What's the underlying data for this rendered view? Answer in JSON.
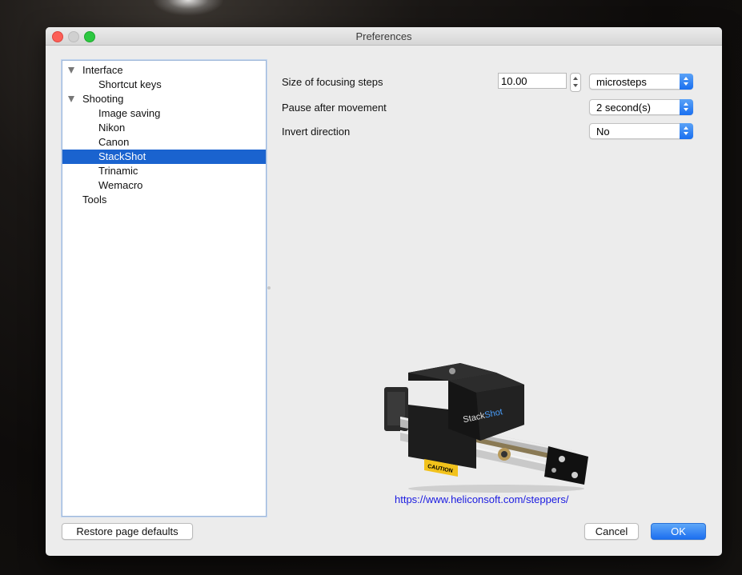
{
  "window": {
    "title": "Preferences"
  },
  "tree": {
    "items": [
      {
        "label": "Interface",
        "expanded": true
      },
      {
        "label": "Shortcut keys"
      },
      {
        "label": "Shooting",
        "expanded": true
      },
      {
        "label": "Image saving"
      },
      {
        "label": "Nikon"
      },
      {
        "label": "Canon"
      },
      {
        "label": "StackShot",
        "selected": true
      },
      {
        "label": "Trinamic"
      },
      {
        "label": "Wemacro"
      },
      {
        "label": "Tools"
      }
    ]
  },
  "settings": {
    "focus_steps": {
      "label": "Size of focusing steps",
      "value": "10.00",
      "unit": "microsteps"
    },
    "pause": {
      "label": "Pause after movement",
      "value": "2  second(s)"
    },
    "invert": {
      "label": "Invert direction",
      "value": "No"
    }
  },
  "product": {
    "brand_a": "Stack",
    "brand_b": "Shot",
    "caution": "CAUTION"
  },
  "link": "https://www.heliconsoft.com/steppers/",
  "buttons": {
    "restore": "Restore page defaults",
    "cancel": "Cancel",
    "ok": "OK"
  },
  "colors": {
    "selection": "#1a63cf",
    "accent": "#1c6ff0",
    "link": "#1a1ae0"
  }
}
